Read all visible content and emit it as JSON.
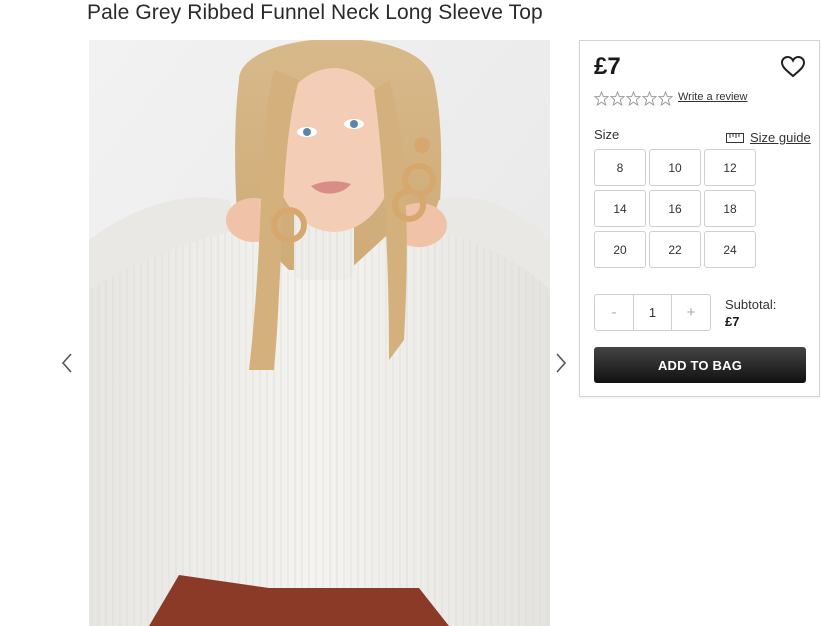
{
  "product": {
    "title": "Pale Grey Ribbed Funnel Neck Long Sleeve Top",
    "price": "£7",
    "rating_stars": 5,
    "rating_filled": 0,
    "write_review": "Write a review"
  },
  "sizes": {
    "label": "Size",
    "guide_label": "Size guide",
    "options": [
      "8",
      "10",
      "12",
      "14",
      "16",
      "18",
      "20",
      "22",
      "24"
    ]
  },
  "quantity": {
    "minus": "-",
    "value": "1",
    "plus": "+"
  },
  "subtotal": {
    "label": "Subtotal:",
    "value": "£7"
  },
  "cta": {
    "add_to_bag": "ADD TO BAG"
  },
  "icons": {
    "prev": "chevron-left-icon",
    "next": "chevron-right-icon",
    "wishlist": "heart-icon",
    "rating": "star-icon",
    "size_guide": "ruler-icon"
  },
  "colors": {
    "top": "#f1f0ed",
    "cta": "#1a1a1a",
    "border": "#cfcfcf",
    "skirt": "#8a3a26"
  }
}
